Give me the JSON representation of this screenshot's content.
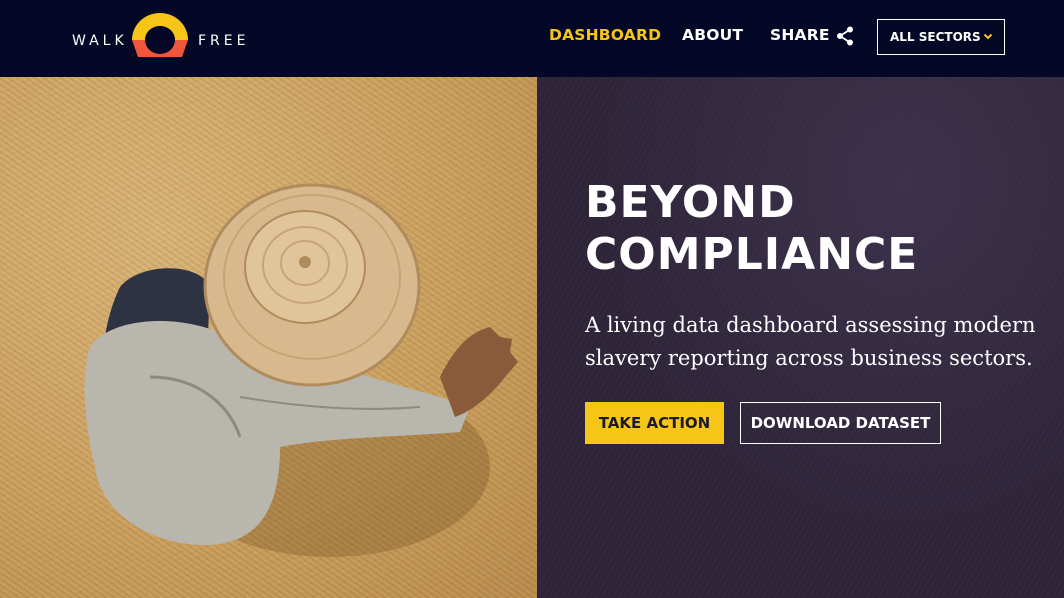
{
  "header": {
    "logo": {
      "left_word": "WALK",
      "right_word": "FREE"
    },
    "nav": {
      "dashboard": "DASHBOARD",
      "about": "ABOUT",
      "share": "SHARE"
    },
    "sector_select": {
      "selected": "ALL SECTORS"
    }
  },
  "hero": {
    "image": "worker-in-straw-hat-drying-grain-photo",
    "title_line1": "BEYOND",
    "title_line2": "COMPLIANCE",
    "subtitle": "A living data dashboard assessing modern slavery reporting across business sectors.",
    "primary_button": "TAKE ACTION",
    "secondary_button": "DOWNLOAD DATASET"
  },
  "colors": {
    "navbar_bg": "#050727",
    "accent_yellow": "#f5c518",
    "logo_orange": "#f0563a",
    "panel_bg": "#2e2539"
  }
}
